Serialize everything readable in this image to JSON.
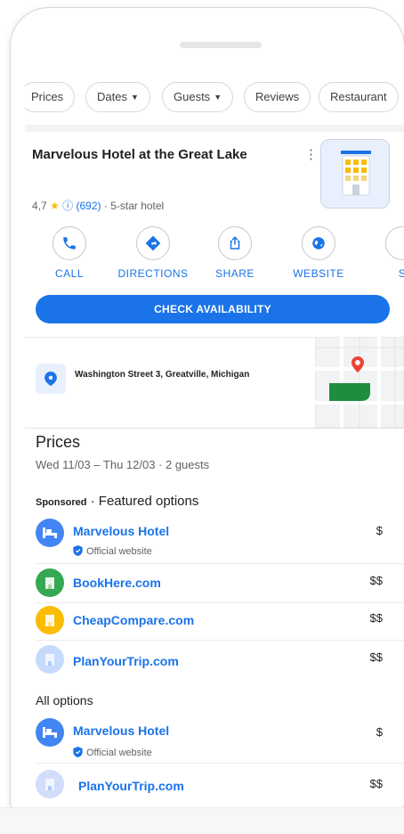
{
  "chips": [
    {
      "label": "Prices",
      "caret": false
    },
    {
      "label": "Dates",
      "caret": true
    },
    {
      "label": "Guests",
      "caret": true
    },
    {
      "label": "Reviews",
      "caret": false
    },
    {
      "label": "Restaurant",
      "caret": false
    }
  ],
  "hotel": {
    "title": "Marvelous Hotel at the Great Lake",
    "rating": "4,7",
    "review_count": "(692)",
    "category": "· 5-star hotel"
  },
  "actions": [
    {
      "label": "CALL",
      "icon": "phone-icon"
    },
    {
      "label": "DIRECTIONS",
      "icon": "directions-icon"
    },
    {
      "label": "SHARE",
      "icon": "share-icon"
    },
    {
      "label": "WEBSITE",
      "icon": "globe-icon"
    },
    {
      "label": "S",
      "icon": "save-icon"
    }
  ],
  "cta_label": "CHECK AVAILABILITY",
  "address": "Washington Street 3, Greatville, Michigan",
  "prices": {
    "heading": "Prices",
    "subtitle": "Wed 11/03 – Thu 12/03 · 2 guests",
    "sponsored_label": "Sponsored",
    "featured_label": " · Featured options",
    "all_options_label": "All options",
    "official_label": "Official website",
    "featured": [
      {
        "name": "Marvelous Hotel",
        "price": "$",
        "official": true,
        "color": "#4285f4",
        "icon": "bed-icon"
      },
      {
        "name": "BookHere.com",
        "price": "$$",
        "official": false,
        "color": "#34a853",
        "icon": "building-icon"
      },
      {
        "name": "CheapCompare.com",
        "price": "$$",
        "official": false,
        "color": "#fbbc04",
        "icon": "building-icon"
      },
      {
        "name": "PlanYourTrip.com",
        "price": "$$",
        "official": false,
        "color": "#c6dafc",
        "icon": "building-icon"
      }
    ],
    "all": [
      {
        "name": "Marvelous Hotel",
        "price": "$",
        "official": true,
        "color": "#4285f4",
        "icon": "bed-icon"
      },
      {
        "name": "PlanYourTrip.com",
        "price": "$$",
        "official": false,
        "color": "#d2dcfb",
        "icon": "building-icon"
      }
    ]
  },
  "colors": {
    "accent": "#1a73e8",
    "star": "#fbbc04",
    "map_park": "#1e8e3e",
    "map_pin": "#ea4335"
  }
}
